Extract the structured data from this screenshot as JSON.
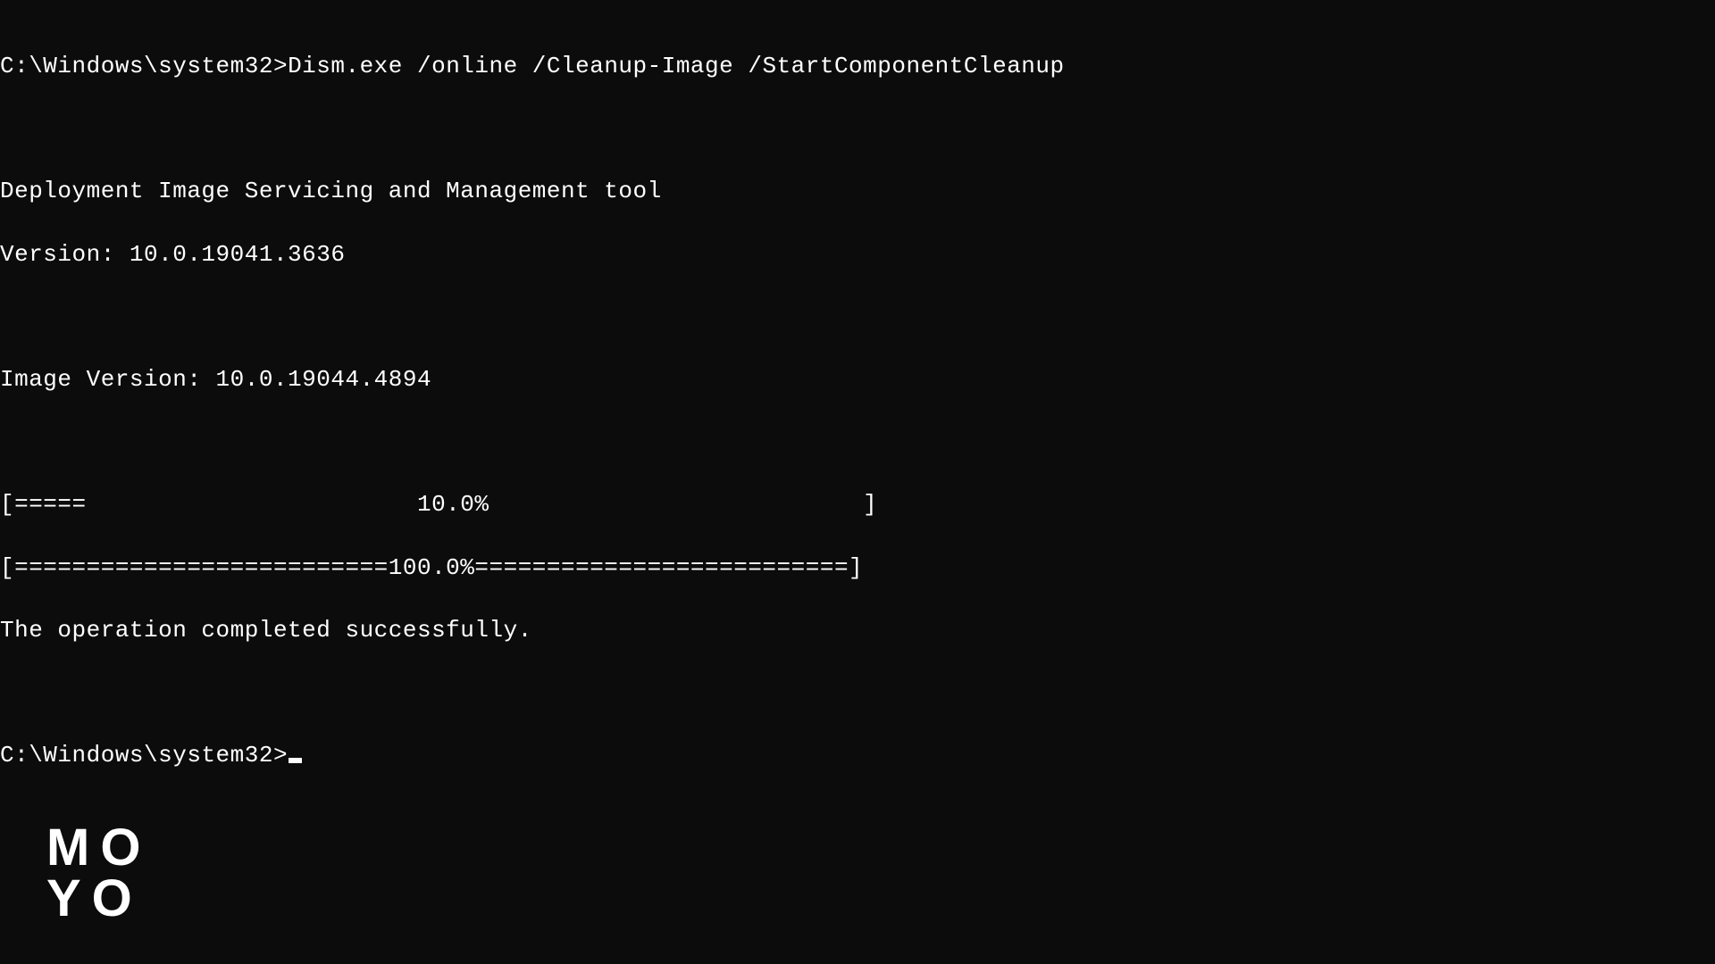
{
  "terminal": {
    "prompt1": "C:\\Windows\\system32>",
    "command": "Dism.exe /online /Cleanup-Image /StartComponentCleanup",
    "tool_name": "Deployment Image Servicing and Management tool",
    "version_line": "Version: 10.0.19041.3636",
    "image_version_line": "Image Version: 10.0.19044.4894",
    "progress_10": "[=====                       10.0%                          ] ",
    "progress_100": "[==========================100.0%==========================] ",
    "success_message": "The operation completed successfully.",
    "prompt2": "C:\\Windows\\system32>"
  },
  "watermark": {
    "line1": "MO",
    "line2": "YO"
  }
}
